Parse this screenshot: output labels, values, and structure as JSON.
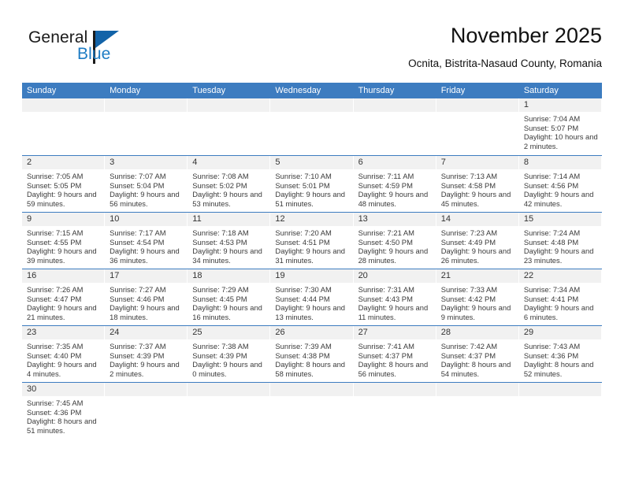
{
  "brand": {
    "name_part1": "General",
    "name_part2": "Blue",
    "color_dark": "#1a1a1a",
    "color_blue": "#1d7cc4",
    "triangle_color": "#1263a8"
  },
  "header": {
    "title": "November 2025",
    "subtitle": "Ocnita, Bistrita-Nasaud County, Romania"
  },
  "theme": {
    "header_blue": "#3d7cc0",
    "day_band_gray": "#f1f1f1",
    "text_color": "#3a3a3a"
  },
  "weekdays": [
    "Sunday",
    "Monday",
    "Tuesday",
    "Wednesday",
    "Thursday",
    "Friday",
    "Saturday"
  ],
  "labels": {
    "sunrise": "Sunrise:",
    "sunset": "Sunset:",
    "daylight": "Daylight:"
  },
  "weeks": [
    [
      {
        "day": "",
        "empty": true
      },
      {
        "day": "",
        "empty": true
      },
      {
        "day": "",
        "empty": true
      },
      {
        "day": "",
        "empty": true
      },
      {
        "day": "",
        "empty": true
      },
      {
        "day": "",
        "empty": true
      },
      {
        "day": "1",
        "sunrise": "Sunrise: 7:04 AM",
        "sunset": "Sunset: 5:07 PM",
        "daylight": "Daylight: 10 hours and 2 minutes."
      }
    ],
    [
      {
        "day": "2",
        "sunrise": "Sunrise: 7:05 AM",
        "sunset": "Sunset: 5:05 PM",
        "daylight": "Daylight: 9 hours and 59 minutes."
      },
      {
        "day": "3",
        "sunrise": "Sunrise: 7:07 AM",
        "sunset": "Sunset: 5:04 PM",
        "daylight": "Daylight: 9 hours and 56 minutes."
      },
      {
        "day": "4",
        "sunrise": "Sunrise: 7:08 AM",
        "sunset": "Sunset: 5:02 PM",
        "daylight": "Daylight: 9 hours and 53 minutes."
      },
      {
        "day": "5",
        "sunrise": "Sunrise: 7:10 AM",
        "sunset": "Sunset: 5:01 PM",
        "daylight": "Daylight: 9 hours and 51 minutes."
      },
      {
        "day": "6",
        "sunrise": "Sunrise: 7:11 AM",
        "sunset": "Sunset: 4:59 PM",
        "daylight": "Daylight: 9 hours and 48 minutes."
      },
      {
        "day": "7",
        "sunrise": "Sunrise: 7:13 AM",
        "sunset": "Sunset: 4:58 PM",
        "daylight": "Daylight: 9 hours and 45 minutes."
      },
      {
        "day": "8",
        "sunrise": "Sunrise: 7:14 AM",
        "sunset": "Sunset: 4:56 PM",
        "daylight": "Daylight: 9 hours and 42 minutes."
      }
    ],
    [
      {
        "day": "9",
        "sunrise": "Sunrise: 7:15 AM",
        "sunset": "Sunset: 4:55 PM",
        "daylight": "Daylight: 9 hours and 39 minutes."
      },
      {
        "day": "10",
        "sunrise": "Sunrise: 7:17 AM",
        "sunset": "Sunset: 4:54 PM",
        "daylight": "Daylight: 9 hours and 36 minutes."
      },
      {
        "day": "11",
        "sunrise": "Sunrise: 7:18 AM",
        "sunset": "Sunset: 4:53 PM",
        "daylight": "Daylight: 9 hours and 34 minutes."
      },
      {
        "day": "12",
        "sunrise": "Sunrise: 7:20 AM",
        "sunset": "Sunset: 4:51 PM",
        "daylight": "Daylight: 9 hours and 31 minutes."
      },
      {
        "day": "13",
        "sunrise": "Sunrise: 7:21 AM",
        "sunset": "Sunset: 4:50 PM",
        "daylight": "Daylight: 9 hours and 28 minutes."
      },
      {
        "day": "14",
        "sunrise": "Sunrise: 7:23 AM",
        "sunset": "Sunset: 4:49 PM",
        "daylight": "Daylight: 9 hours and 26 minutes."
      },
      {
        "day": "15",
        "sunrise": "Sunrise: 7:24 AM",
        "sunset": "Sunset: 4:48 PM",
        "daylight": "Daylight: 9 hours and 23 minutes."
      }
    ],
    [
      {
        "day": "16",
        "sunrise": "Sunrise: 7:26 AM",
        "sunset": "Sunset: 4:47 PM",
        "daylight": "Daylight: 9 hours and 21 minutes."
      },
      {
        "day": "17",
        "sunrise": "Sunrise: 7:27 AM",
        "sunset": "Sunset: 4:46 PM",
        "daylight": "Daylight: 9 hours and 18 minutes."
      },
      {
        "day": "18",
        "sunrise": "Sunrise: 7:29 AM",
        "sunset": "Sunset: 4:45 PM",
        "daylight": "Daylight: 9 hours and 16 minutes."
      },
      {
        "day": "19",
        "sunrise": "Sunrise: 7:30 AM",
        "sunset": "Sunset: 4:44 PM",
        "daylight": "Daylight: 9 hours and 13 minutes."
      },
      {
        "day": "20",
        "sunrise": "Sunrise: 7:31 AM",
        "sunset": "Sunset: 4:43 PM",
        "daylight": "Daylight: 9 hours and 11 minutes."
      },
      {
        "day": "21",
        "sunrise": "Sunrise: 7:33 AM",
        "sunset": "Sunset: 4:42 PM",
        "daylight": "Daylight: 9 hours and 9 minutes."
      },
      {
        "day": "22",
        "sunrise": "Sunrise: 7:34 AM",
        "sunset": "Sunset: 4:41 PM",
        "daylight": "Daylight: 9 hours and 6 minutes."
      }
    ],
    [
      {
        "day": "23",
        "sunrise": "Sunrise: 7:35 AM",
        "sunset": "Sunset: 4:40 PM",
        "daylight": "Daylight: 9 hours and 4 minutes."
      },
      {
        "day": "24",
        "sunrise": "Sunrise: 7:37 AM",
        "sunset": "Sunset: 4:39 PM",
        "daylight": "Daylight: 9 hours and 2 minutes."
      },
      {
        "day": "25",
        "sunrise": "Sunrise: 7:38 AM",
        "sunset": "Sunset: 4:39 PM",
        "daylight": "Daylight: 9 hours and 0 minutes."
      },
      {
        "day": "26",
        "sunrise": "Sunrise: 7:39 AM",
        "sunset": "Sunset: 4:38 PM",
        "daylight": "Daylight: 8 hours and 58 minutes."
      },
      {
        "day": "27",
        "sunrise": "Sunrise: 7:41 AM",
        "sunset": "Sunset: 4:37 PM",
        "daylight": "Daylight: 8 hours and 56 minutes."
      },
      {
        "day": "28",
        "sunrise": "Sunrise: 7:42 AM",
        "sunset": "Sunset: 4:37 PM",
        "daylight": "Daylight: 8 hours and 54 minutes."
      },
      {
        "day": "29",
        "sunrise": "Sunrise: 7:43 AM",
        "sunset": "Sunset: 4:36 PM",
        "daylight": "Daylight: 8 hours and 52 minutes."
      }
    ],
    [
      {
        "day": "30",
        "sunrise": "Sunrise: 7:45 AM",
        "sunset": "Sunset: 4:36 PM",
        "daylight": "Daylight: 8 hours and 51 minutes."
      },
      {
        "day": "",
        "empty": true
      },
      {
        "day": "",
        "empty": true
      },
      {
        "day": "",
        "empty": true
      },
      {
        "day": "",
        "empty": true
      },
      {
        "day": "",
        "empty": true
      },
      {
        "day": "",
        "empty": true
      }
    ]
  ]
}
